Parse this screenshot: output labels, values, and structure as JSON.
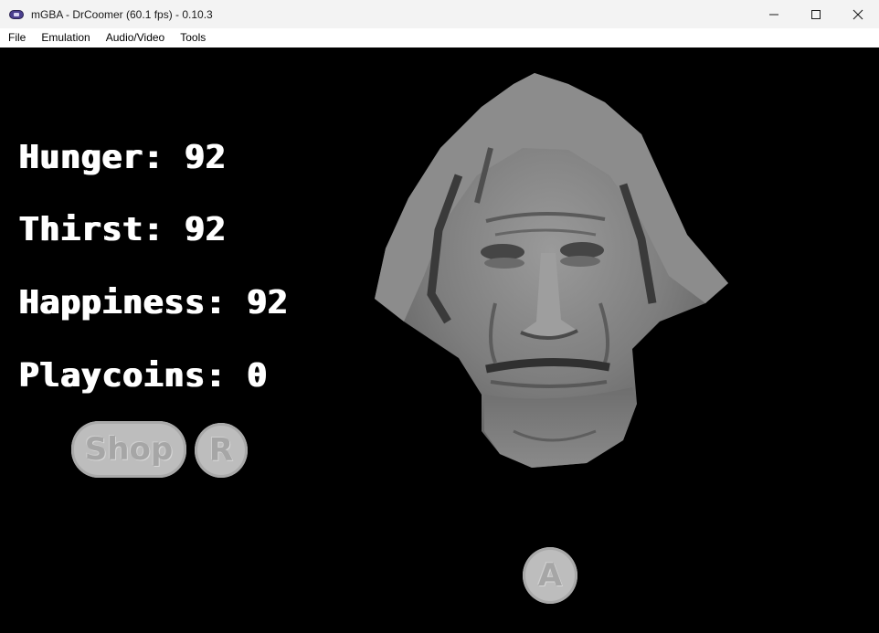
{
  "window": {
    "title": "mGBA - DrCoomer (60.1 fps) - 0.10.3",
    "controls": [
      "minimize-icon",
      "maximize-icon",
      "close-icon"
    ]
  },
  "menubar": {
    "items": [
      {
        "label": "File"
      },
      {
        "label": "Emulation"
      },
      {
        "label": "Audio/Video"
      },
      {
        "label": "Tools"
      }
    ]
  },
  "game": {
    "stats": [
      {
        "label": "Hunger:",
        "value": "92"
      },
      {
        "label": "Thirst:",
        "value": "92"
      },
      {
        "label": "Happiness:",
        "value": "92"
      },
      {
        "label": "Playcoins:",
        "value": "0"
      }
    ],
    "shop_button": "Shop",
    "r_button": "R",
    "a_button": "A",
    "character_image": "grayscale-pixel-face"
  },
  "colors": {
    "titlebar_bg": "#f3f3f3",
    "menubar_bg": "#ffffff",
    "screen_bg": "#000000",
    "stat_text": "#ffffff",
    "button_fill": "#bdbdbd"
  }
}
